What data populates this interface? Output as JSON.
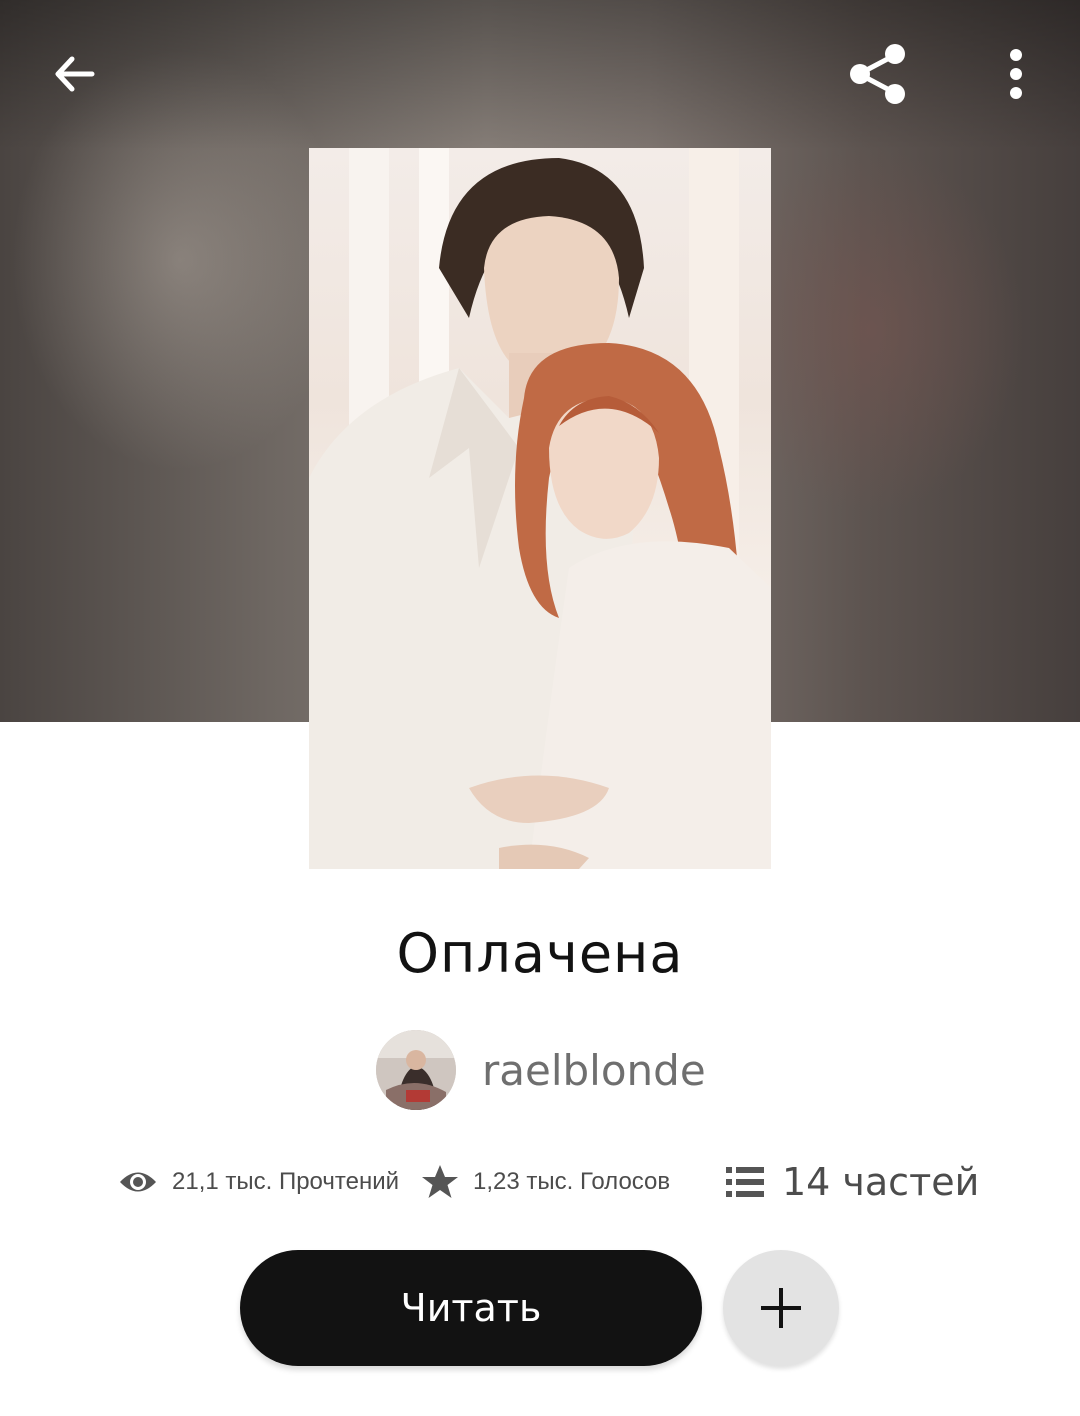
{
  "header": {
    "back_icon": "arrow-left-icon",
    "share_icon": "share-icon",
    "more_icon": "more-vertical-icon"
  },
  "story": {
    "title": "Оплачена",
    "author": "raelblonde"
  },
  "stats": {
    "reads": "21,1 тыс. Прочтений",
    "votes": "1,23 тыс. Голосов",
    "parts": "14 частей",
    "reads_icon": "eye-icon",
    "votes_icon": "star-icon",
    "parts_icon": "list-icon"
  },
  "actions": {
    "read_label": "Читать",
    "add_icon": "plus-icon"
  },
  "colors": {
    "primary_button": "#121212",
    "secondary_button": "#e3e3e3",
    "muted_text": "#6f6f6f"
  }
}
